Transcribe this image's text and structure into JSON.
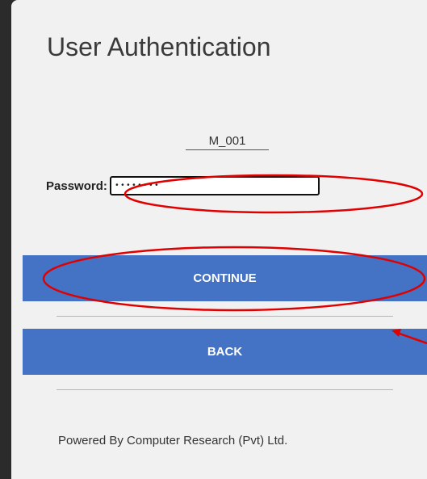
{
  "page": {
    "title": "User Authentication",
    "username": "M_001"
  },
  "password": {
    "label": "Password:",
    "value": "••••••••"
  },
  "buttons": {
    "continue_label": "CONTINUE",
    "back_label": "BACK"
  },
  "footer": {
    "text": "Powered By Computer Research (Pvt) Ltd."
  },
  "colors": {
    "button_bg": "#4472c4",
    "annotation": "#e00000",
    "panel_bg": "#f1f1f1",
    "frame_bg": "#2b2b2b"
  }
}
